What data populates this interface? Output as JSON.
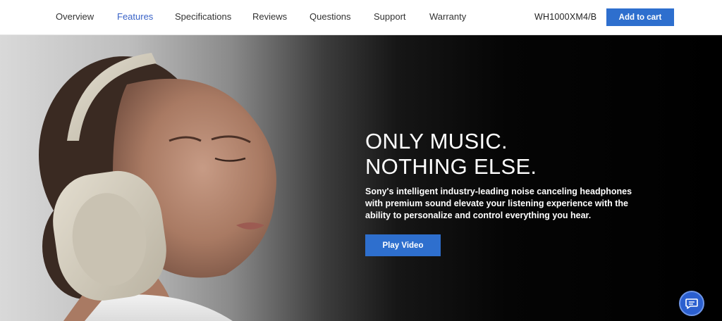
{
  "nav": {
    "items": [
      {
        "label": "Overview"
      },
      {
        "label": "Features"
      },
      {
        "label": "Specifications"
      },
      {
        "label": "Reviews"
      },
      {
        "label": "Questions"
      },
      {
        "label": "Support"
      },
      {
        "label": "Warranty"
      }
    ],
    "active": "Features",
    "model": "WH1000XM4/B",
    "cart_label": "Add to cart"
  },
  "hero": {
    "headline_line1": "ONLY MUSIC.",
    "headline_line2": "NOTHING ELSE.",
    "description": "Sony's intelligent industry-leading noise canceling headphones with premium sound elevate your listening experience with the ability to personalize and control everything you hear.",
    "play_label": "Play Video",
    "image_icon": "woman-wearing-headphones-photo"
  },
  "chat": {
    "icon": "chat-bubble-icon"
  },
  "colors": {
    "accent": "#2e6fce",
    "active_nav": "#3a63c7",
    "chat": "#2b5fcf"
  }
}
